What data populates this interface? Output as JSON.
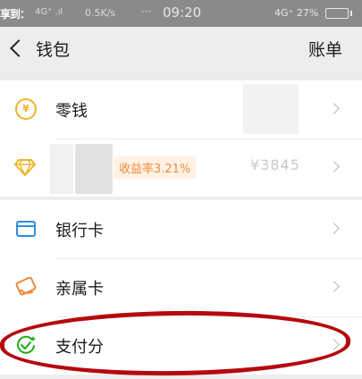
{
  "status_bar": {
    "left_text": "享到：",
    "signal_text": "4G⁺ .ıl",
    "speed": "0.5K/s",
    "dots": "···",
    "time": "09:20",
    "right_text": "4G⁺ 27%"
  },
  "nav": {
    "title": "钱包",
    "right_label": "账单"
  },
  "wallet": {
    "change_label": "零钱",
    "licaitong_yield": "收益率3.21%",
    "licaitong_amount": "¥3845"
  },
  "cards": {
    "bank_card_label": "银行卡",
    "family_card_label": "亲属卡",
    "pay_score_label": "支付分"
  },
  "colors": {
    "accent_yellow": "#f0b429",
    "accent_blue": "#2d8ce0",
    "accent_orange": "#ef8a3c",
    "accent_green": "#1aad19",
    "annotation_red": "#b5080f"
  }
}
